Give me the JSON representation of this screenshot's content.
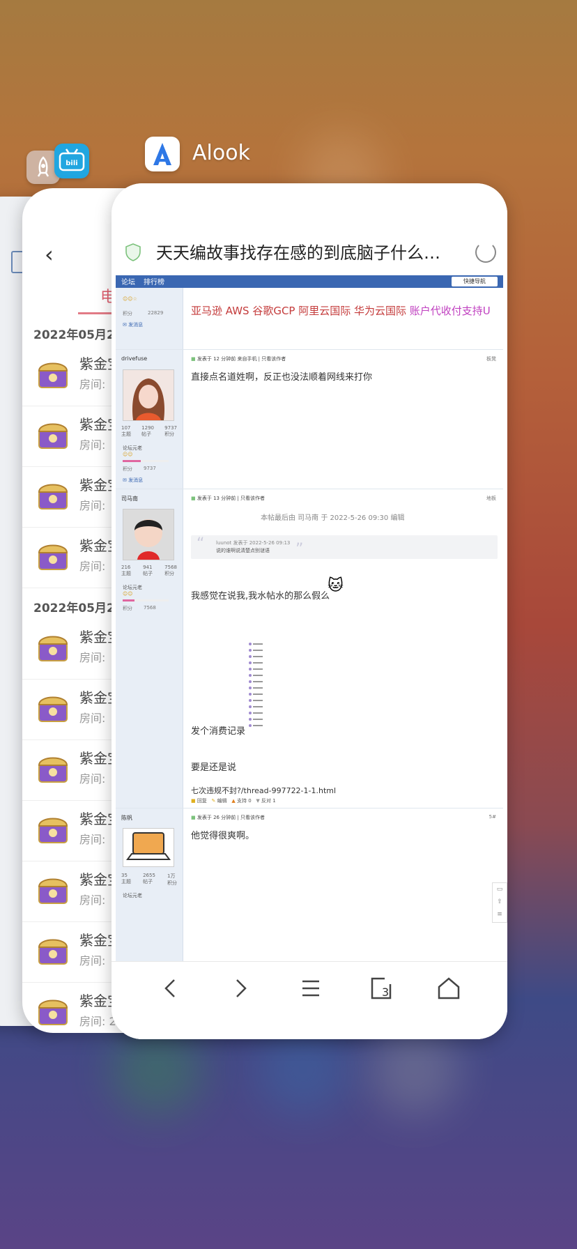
{
  "switcher": {
    "front_app_name": "Alook",
    "background_apps": [
      "bilibili"
    ]
  },
  "mid_card": {
    "back": "‹",
    "tab_label": "电",
    "sections": [
      {
        "date": "2022年05月2",
        "items": [
          {
            "title": "紫金宝",
            "sub": "房间:"
          },
          {
            "title": "紫金宝",
            "sub": "房间:"
          },
          {
            "title": "紫金宝",
            "sub": "房间:"
          },
          {
            "title": "紫金宝",
            "sub": "房间:"
          }
        ]
      },
      {
        "date": "2022年05月2",
        "items": [
          {
            "title": "紫金宝",
            "sub": "房间:"
          },
          {
            "title": "紫金宝",
            "sub": "房间:"
          },
          {
            "title": "紫金宝",
            "sub": "房间:"
          },
          {
            "title": "紫金宝",
            "sub": "房间:"
          },
          {
            "title": "紫金宝",
            "sub": "房间:"
          },
          {
            "title": "紫金宝",
            "sub": "房间:"
          },
          {
            "title": "紫金宝",
            "sub": "房间: 2"
          }
        ]
      }
    ]
  },
  "browser": {
    "title": "天天编故事找存在感的到底脑子什么问...",
    "nav": {
      "forum": "论坛",
      "ranking": "排行榜",
      "quick_nav": "快捷导航"
    },
    "posts": [
      {
        "kind": "promo",
        "score_label": "积分",
        "score": "22829",
        "msg": "发消息",
        "text_red": "亚马逊 AWS 谷歌GCP 阿里云国际 华为云国际 ",
        "text_purple": "账户代收付支持U"
      },
      {
        "kind": "post",
        "user": "drivefuse",
        "meta": "发表于 12 分钟前 来自手机",
        "only_author": "只看该作者",
        "floor": "板凳",
        "stats": [
          {
            "v": "107",
            "l": "主题"
          },
          {
            "v": "1290",
            "l": "帖子"
          },
          {
            "v": "9737",
            "l": "积分"
          }
        ],
        "rank": "论坛元老",
        "score_label": "积分",
        "score": "9737",
        "msg": "发消息",
        "text": "直接点名道姓啊，反正也没法顺着网线来打你"
      },
      {
        "kind": "post",
        "user": "司马南",
        "meta": "发表于 13 分钟前",
        "only_author": "只看该作者",
        "floor": "地板",
        "stats": [
          {
            "v": "216",
            "l": "主题"
          },
          {
            "v": "941",
            "l": "帖子"
          },
          {
            "v": "7568",
            "l": "积分"
          }
        ],
        "rank": "论坛元老",
        "score_label": "积分",
        "score": "7568",
        "edit_note": "本帖最后由 司马南 于 2022-5-26 09:30 编辑",
        "quote_head": "luunot 发表于 2022-5-26 09:13",
        "quote_body": "说的谁啊说清楚点别谜语",
        "line1": "我感觉在说我,我水帖水的那么假么",
        "line2": "发个消费记录",
        "line3": "要是还是说",
        "link": "七次违规不封?/thread-997722-1-1.html",
        "actions": [
          "回复",
          "编辑",
          "支持 0",
          "反对 1"
        ]
      },
      {
        "kind": "post",
        "user": "陈帆",
        "meta": "发表于 26 分钟前",
        "only_author": "只看该作者",
        "floor": "5#",
        "stats": [
          {
            "v": "35",
            "l": "主题"
          },
          {
            "v": "2655",
            "l": "帖子"
          },
          {
            "v": "1万",
            "l": "积分"
          }
        ],
        "rank": "论坛元老",
        "text": "他觉得很爽啊。"
      }
    ],
    "toolbar": {
      "tabs_count": "3"
    }
  }
}
